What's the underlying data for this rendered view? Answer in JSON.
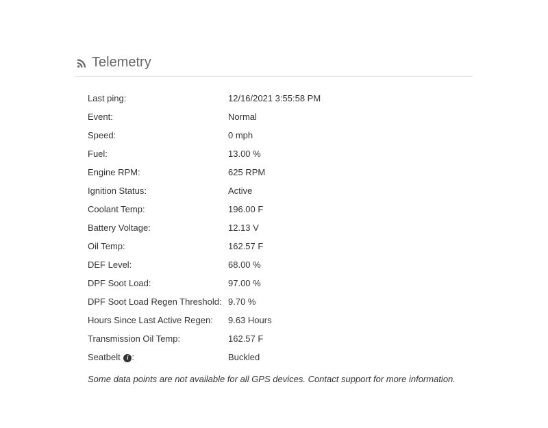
{
  "panel": {
    "title": "Telemetry"
  },
  "rows": {
    "last_ping": {
      "label": "Last ping:",
      "value": "12/16/2021 3:55:58 PM"
    },
    "event": {
      "label": "Event:",
      "value": "Normal"
    },
    "speed": {
      "label": "Speed:",
      "value": "0 mph"
    },
    "fuel": {
      "label": "Fuel:",
      "value": "13.00 %"
    },
    "engine_rpm": {
      "label": "Engine RPM:",
      "value": "625 RPM"
    },
    "ignition_status": {
      "label": "Ignition Status:",
      "value": "Active"
    },
    "coolant_temp": {
      "label": "Coolant Temp:",
      "value": "196.00 F"
    },
    "battery_voltage": {
      "label": "Battery Voltage:",
      "value": "12.13 V"
    },
    "oil_temp": {
      "label": "Oil Temp:",
      "value": "162.57 F"
    },
    "def_level": {
      "label": "DEF Level:",
      "value": "68.00 %"
    },
    "dpf_soot_load": {
      "label": "DPF Soot Load:",
      "value": "97.00 %"
    },
    "dpf_soot_load_regen_threshold": {
      "label": "DPF Soot Load Regen Threshold:",
      "value": "9.70 %"
    },
    "hours_since_last_regen": {
      "label": "Hours Since Last Active Regen:",
      "value": "9.63 Hours"
    },
    "transmission_oil_temp": {
      "label": "Transmission Oil Temp:",
      "value": "162.57 F"
    },
    "seatbelt": {
      "label_prefix": "Seatbelt ",
      "label_suffix": ":",
      "value": "Buckled"
    }
  },
  "footer_note": "Some data points are not available for all GPS devices. Contact support for more information."
}
